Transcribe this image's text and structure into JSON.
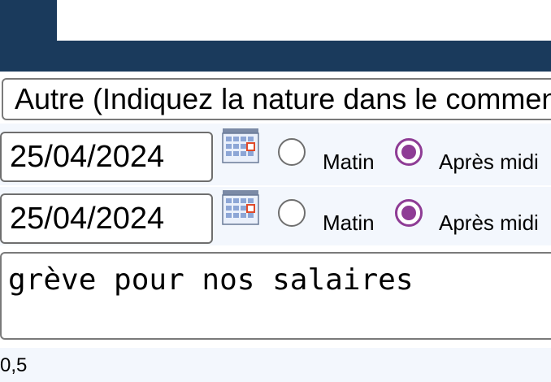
{
  "type_select": {
    "value": "Autre (Indiquez la nature dans le commentaire)"
  },
  "start": {
    "date": "25/04/2024",
    "options": [
      {
        "label": "Matin",
        "checked": false
      },
      {
        "label": "Après midi",
        "checked": true
      }
    ]
  },
  "end": {
    "date": "25/04/2024",
    "options": [
      {
        "label": "Matin",
        "checked": false
      },
      {
        "label": "Après midi",
        "checked": true
      }
    ]
  },
  "comment": {
    "value": "grève pour nos salaires"
  },
  "duration": {
    "value": "0,5"
  },
  "colors": {
    "header": "#1a3a5c",
    "radio_accent": "#8e3c95",
    "row_bg": "#f3f7fd"
  },
  "icons": {
    "calendar": "calendar-icon"
  }
}
